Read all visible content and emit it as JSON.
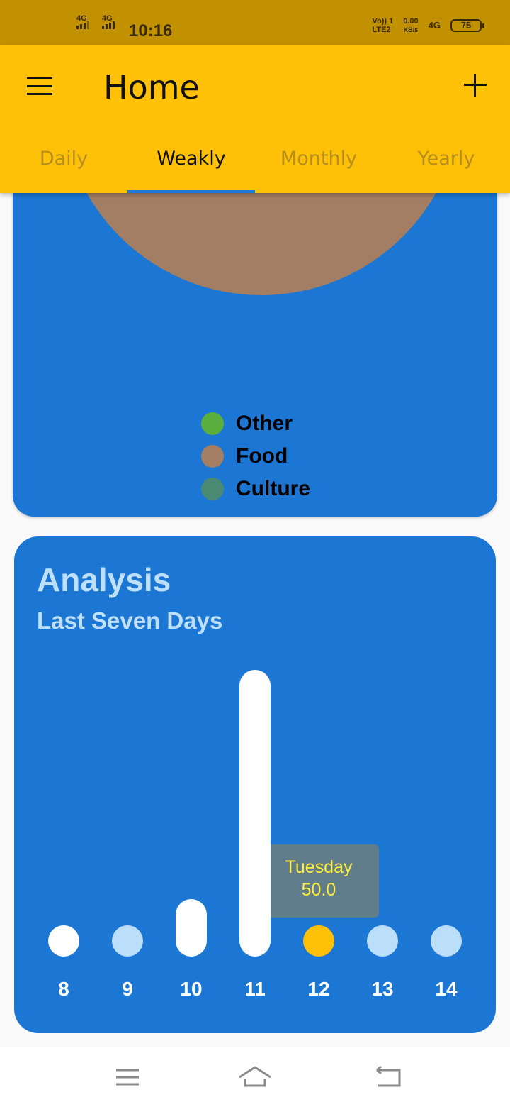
{
  "status_bar": {
    "time": "10:16",
    "sim1_label": "4G",
    "sim2_label": "4G",
    "volte_line1": "Vo)) 1",
    "volte_line2": "LTE2",
    "speed_value": "0.00",
    "speed_unit": "KB/s",
    "network_right": "4G",
    "battery": "75"
  },
  "app_bar": {
    "title": "Home",
    "tabs": [
      {
        "label": "Daily",
        "active": false
      },
      {
        "label": "Weakly",
        "active": true
      },
      {
        "label": "Monthly",
        "active": false
      },
      {
        "label": "Yearly",
        "active": false
      }
    ]
  },
  "pie_card": {
    "legend": [
      {
        "label": "Other",
        "color": "#5aae3d"
      },
      {
        "label": "Food",
        "color": "#a37e62"
      },
      {
        "label": "Culture",
        "color": "#4a8a73"
      }
    ]
  },
  "analysis_card": {
    "title": "Analysis",
    "subtitle": "Last Seven Days"
  },
  "chart_data": {
    "type": "bar",
    "title": "Analysis",
    "subtitle": "Last Seven Days",
    "categories": [
      "8",
      "9",
      "10",
      "11",
      "12",
      "13",
      "14"
    ],
    "values": [
      0,
      0,
      10,
      50,
      0,
      0,
      0
    ],
    "ylim": [
      0,
      50
    ],
    "bar_colors": [
      "#ffffff",
      "#bbdefb",
      "#ffffff",
      "#ffffff",
      "#ffc107",
      "#bbdefb",
      "#bbdefb"
    ],
    "tooltip": {
      "category": "12",
      "label": "Tuesday",
      "value": "50.0"
    },
    "grid": false
  }
}
